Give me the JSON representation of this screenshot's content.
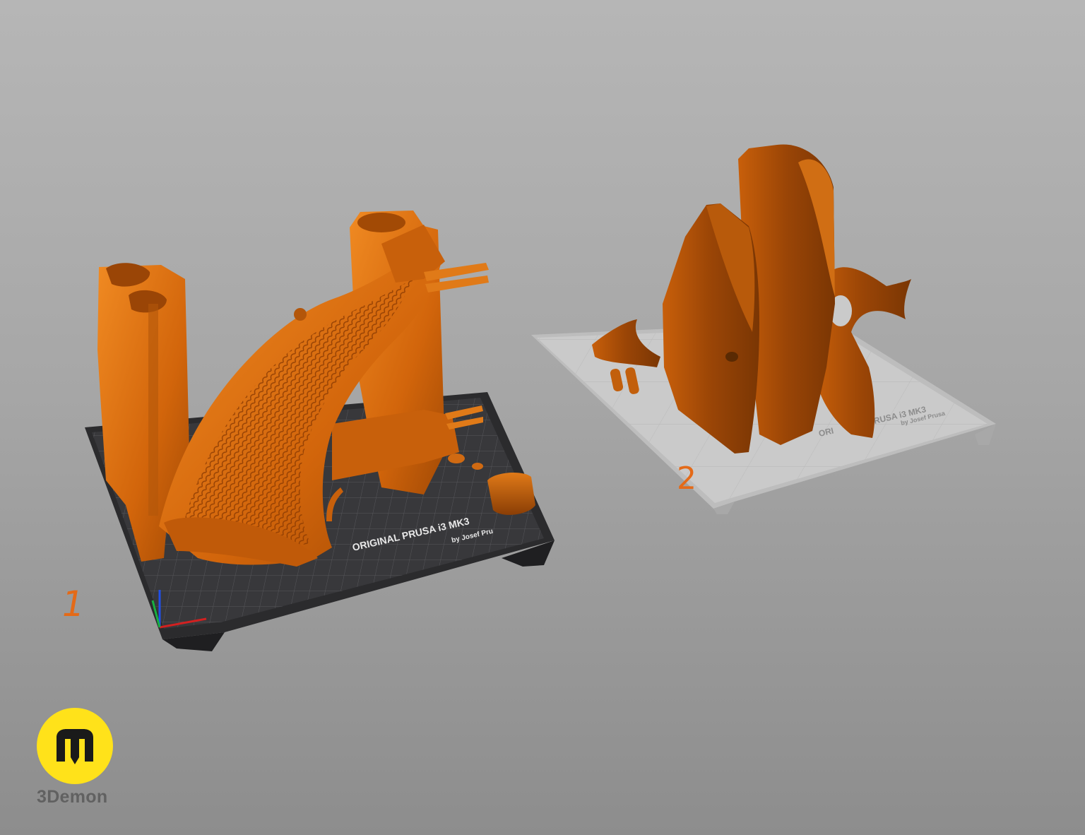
{
  "viewport": {
    "background": "#a8a8a8",
    "model_color": "#d8680c"
  },
  "plate_1": {
    "number": "1",
    "brand_line1": "ORIGINAL PRUSA i3  MK3",
    "brand_line2": "by Josef Pru",
    "bed_color": "#2e2e30"
  },
  "plate_2": {
    "number": "2",
    "brand_line1_left": "ORI",
    "brand_line1_right": "RUSA i3  MK3",
    "brand_line2": "by Josef Prusa",
    "bed_color": "#c8c8c8"
  },
  "watermark": {
    "name": "3Demon",
    "logo_color": "#ffe21a",
    "icon": "3demon-logo-icon"
  }
}
